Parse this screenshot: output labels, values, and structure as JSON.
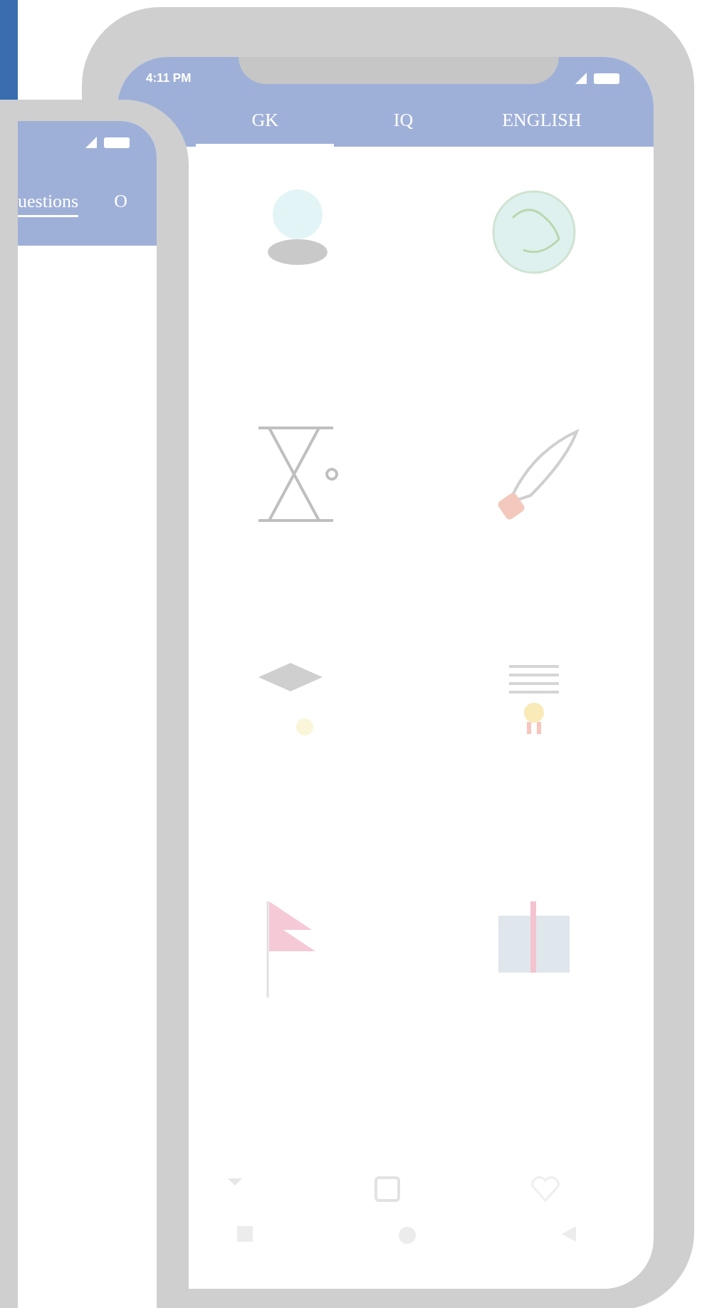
{
  "back_phone": {
    "tabs": [
      {
        "label": "uestions",
        "selected": true
      },
      {
        "label": "O",
        "selected": false
      }
    ]
  },
  "front_phone": {
    "status_bar": {
      "time": "4:11 PM"
    },
    "tabs": [
      {
        "label": "GK",
        "selected": true
      },
      {
        "label": "IQ",
        "selected": false
      },
      {
        "label": "ENGLISH",
        "selected": false
      }
    ]
  }
}
